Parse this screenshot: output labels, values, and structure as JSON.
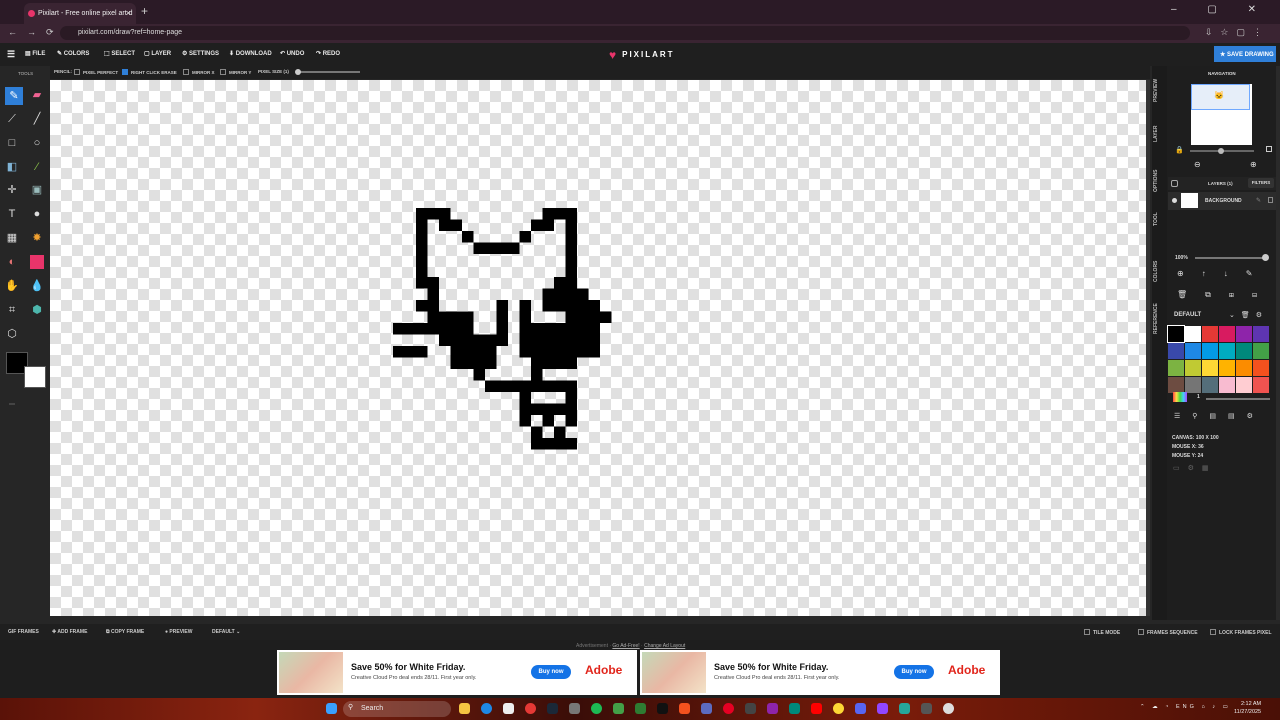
{
  "browser": {
    "tab_title": "Pixilart - Free online pixel art d",
    "url": "pixilart.com/draw?ref=home-page",
    "window_controls": "–  ▢  ✕"
  },
  "app": {
    "logo": "PIXILART",
    "menu": [
      "FILE",
      "COLORS",
      "SELECT",
      "LAYER",
      "SETTINGS",
      "DOWNLOAD",
      "UNDO",
      "REDO"
    ],
    "save_button": "SAVE DRAWING"
  },
  "options": {
    "label": "PENCIL:",
    "pixel_perfect": "PIXEL PERFECT",
    "right_click_erase": "RIGHT CLICK ERASE",
    "mirror_x": "MIRROR X",
    "mirror_y": "MIRROR Y",
    "pixel_size": "PIXEL SIZE (1)"
  },
  "tools_title": "TOOLS",
  "side_tabs": [
    "PREVIEW",
    "LAYER",
    "OPTIONS",
    "TOOL",
    "COLORS",
    "REFERENCE"
  ],
  "navigation": {
    "title": "NAVIGATION"
  },
  "layers": {
    "header": "LAYERS (1)",
    "filters": "FILTERS",
    "name": "BACKGROUND",
    "opacity": "100%"
  },
  "palette": {
    "name": "DEFAULT",
    "brush_count": "1",
    "colors": [
      "#000000",
      "#ffffff",
      "#e53935",
      "#d81b60",
      "#8e24aa",
      "#5e35b1",
      "#3949ab",
      "#1e88e5",
      "#039be5",
      "#00acc1",
      "#00897b",
      "#43a047",
      "#7cb342",
      "#c0ca33",
      "#fdd835",
      "#ffb300",
      "#fb8c00",
      "#f4511e",
      "#6d4c41",
      "#757575",
      "#546e7a",
      "#f8bbd0",
      "#ffcdd2",
      "#ef5350"
    ]
  },
  "info": {
    "canvas": "CANVAS: 100 X 100",
    "mouse_x": "MOUSE X: 36",
    "mouse_y": "MOUSE Y: 24"
  },
  "bottom": {
    "gif_frames": "GIF FRAMES",
    "add_frame": "ADD FRAME",
    "copy_frame": "COPY FRAME",
    "preview": "PREVIEW",
    "default": "DEFAULT",
    "tile_mode": "TILE MODE",
    "frames_sequence": "FRAMES SEQUENCE",
    "lock_frames_pixel": "LOCK FRAMES PIXEL"
  },
  "ad": {
    "note": "Advertisement · ",
    "go_ad_free": "Go Ad-Free!",
    "sep": " · ",
    "change_layout": "Change Ad Layout",
    "headline": "Save 50% for White Friday.",
    "sub": "Creative Cloud Pro deal ends 28/11. First year only.",
    "buy": "Buy now",
    "brand": "Adobe"
  },
  "taskbar": {
    "search": "Search",
    "lang": "ENG",
    "time": "2:12 AM",
    "date": "11/27/2025"
  },
  "colors": {
    "accent": "#2f7fd8",
    "brand": "#e8346a",
    "primary": "#000000",
    "secondary": "#ffffff"
  }
}
